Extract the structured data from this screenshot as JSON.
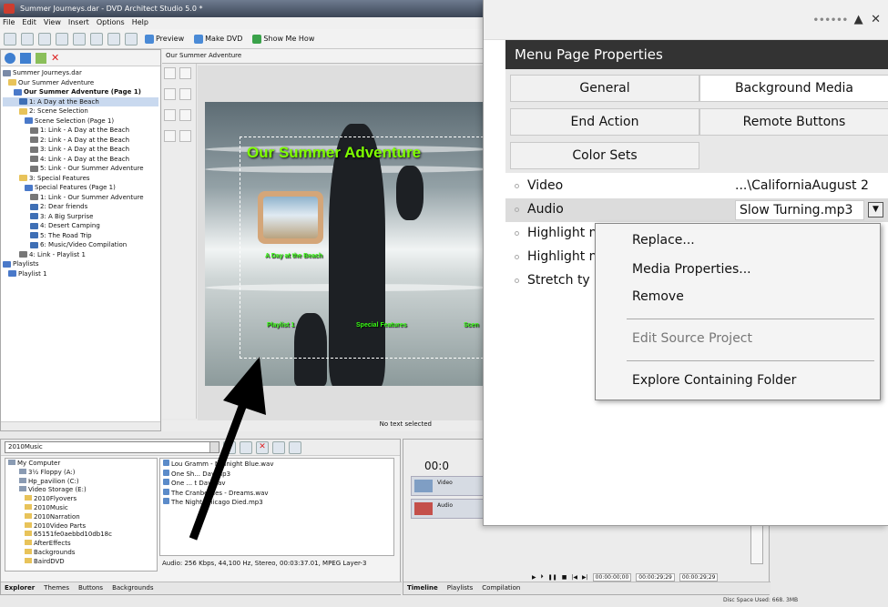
{
  "app": {
    "title": "Summer Journeys.dar - DVD Architect Studio 5.0 *",
    "menu": [
      "File",
      "Edit",
      "View",
      "Insert",
      "Options",
      "Help"
    ],
    "toolbar": {
      "preview": "Preview",
      "make_dvd": "Make DVD",
      "show_me_how": "Show Me How"
    }
  },
  "project_tree": {
    "items": [
      {
        "label": "Summer Journeys.dar",
        "indent": 0,
        "icon": "disc-icon"
      },
      {
        "label": "Our Summer Adventure",
        "indent": 1,
        "icon": "folder-icon"
      },
      {
        "label": "Our Summer Adventure (Page 1)",
        "indent": 2,
        "icon": "menu-page-icon",
        "bold": true
      },
      {
        "label": "1: A Day at the Beach",
        "indent": 3,
        "icon": "movie-icon",
        "selected": true
      },
      {
        "label": "2: Scene Selection",
        "indent": 3,
        "icon": "folder-icon"
      },
      {
        "label": "Scene Selection (Page 1)",
        "indent": 4,
        "icon": "menu-page-icon"
      },
      {
        "label": "1: Link - A Day at the Beach",
        "indent": 5,
        "icon": "link-icon"
      },
      {
        "label": "2: Link - A Day at the Beach",
        "indent": 5,
        "icon": "link-icon"
      },
      {
        "label": "3: Link - A Day at the Beach",
        "indent": 5,
        "icon": "link-icon"
      },
      {
        "label": "4: Link - A Day at the Beach",
        "indent": 5,
        "icon": "link-icon"
      },
      {
        "label": "5: Link - Our Summer Adventure",
        "indent": 5,
        "icon": "link-icon"
      },
      {
        "label": "3: Special Features",
        "indent": 3,
        "icon": "folder-icon"
      },
      {
        "label": "Special Features (Page 1)",
        "indent": 4,
        "icon": "menu-page-icon"
      },
      {
        "label": "1: Link - Our Summer Adventure",
        "indent": 5,
        "icon": "link-icon"
      },
      {
        "label": "2: Dear friends",
        "indent": 5,
        "icon": "movie-icon"
      },
      {
        "label": "3: A Big Surprise",
        "indent": 5,
        "icon": "movie-icon"
      },
      {
        "label": "4: Desert Camping",
        "indent": 5,
        "icon": "movie-icon"
      },
      {
        "label": "5: The Road Trip",
        "indent": 5,
        "icon": "movie-icon"
      },
      {
        "label": "6: Music/Video Compilation",
        "indent": 5,
        "icon": "movie-icon"
      },
      {
        "label": "4: Link - Playlist 1",
        "indent": 3,
        "icon": "link-icon"
      },
      {
        "label": "Playlists",
        "indent": 0,
        "icon": "playlist-icon"
      },
      {
        "label": "Playlist 1",
        "indent": 1,
        "icon": "playlist-icon"
      }
    ]
  },
  "workspace": {
    "tab": "Our Summer Adventure",
    "menu_title": "Our Summer Adventure",
    "thumb_label": "A Day at the Beach",
    "links": [
      "Playlist 1",
      "Special Features",
      "Scen"
    ],
    "status": "No text selected"
  },
  "explorer": {
    "path": "2010Music",
    "tree": [
      "My Computer",
      "3½ Floppy (A:)",
      "Hp_pavilion (C:)",
      "Video Storage (E:)",
      "2010Flyovers",
      "2010Music",
      "2010Narration",
      "2010Video Parts",
      "65151fe0aebbd10db18c",
      "AfterEffects",
      "Backgrounds",
      "BairdDVD"
    ],
    "files": [
      "Lou Gramm - Midnight Blue.wav",
      "One Sh... Day.mp3",
      "One ... t Day.wav",
      "The Cranberries - Dreams.wav",
      "The Night Chicago Died.mp3"
    ],
    "info": "Audio: 256 Kbps, 44,100 Hz, Stereo, 00:03:37.01, MPEG Layer-3",
    "tabs": [
      "Explorer",
      "Themes",
      "Buttons",
      "Backgrounds"
    ]
  },
  "timeline": {
    "time": "00:0",
    "tracks": [
      "Video",
      "Audio"
    ],
    "times": [
      "00:00:00;00",
      "00:00:29;29",
      "00:00:29;29"
    ],
    "tabs": [
      "Timeline",
      "Playlists",
      "Compilation"
    ],
    "disk": "Disc Space Used: 668. 3MB"
  },
  "panel": {
    "header": "Menu Page Properties",
    "tabs": [
      "General",
      "Background Media",
      "End Action",
      "Remote Buttons",
      "Color Sets"
    ],
    "props": [
      {
        "name": "Video",
        "value": "...\\CaliforniaAugust 2"
      },
      {
        "name": "Audio",
        "value": "Slow Turning.mp3"
      },
      {
        "name": "Highlight n",
        "value": ""
      },
      {
        "name": "Highlight n",
        "value": ""
      },
      {
        "name": "Stretch ty",
        "value": ""
      }
    ],
    "context_menu": [
      {
        "label": "Replace...",
        "disabled": false
      },
      {
        "label": "Media Properties...",
        "disabled": false
      },
      {
        "label": "Remove",
        "disabled": false
      },
      {
        "label": "Edit Source Project",
        "disabled": true
      },
      {
        "label": "Explore Containing Folder",
        "disabled": false
      }
    ]
  },
  "colors": {
    "title_green": "#7fff00",
    "panel_header": "#333333",
    "selection": "#dcdcdc"
  }
}
